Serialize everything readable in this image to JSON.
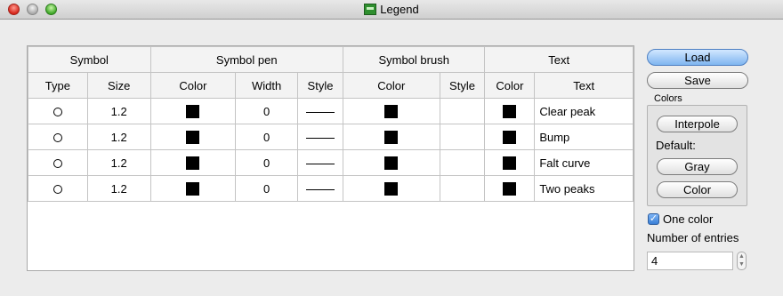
{
  "window": {
    "title": "Legend",
    "icon": "legend-app-icon"
  },
  "table": {
    "group_headers": [
      "Symbol",
      "Symbol pen",
      "Symbol brush",
      "Text"
    ],
    "columns": [
      "Type",
      "Size",
      "Color",
      "Width",
      "Style",
      "Color",
      "Style",
      "Color",
      "Text"
    ],
    "rows": [
      {
        "type": "circle",
        "size": "1.2",
        "pen_color": "#000000",
        "width": "0",
        "pen_style": "solid-line",
        "brush_color": "#000000",
        "brush_style": "",
        "text_color": "#000000",
        "text": "Clear peak"
      },
      {
        "type": "circle",
        "size": "1.2",
        "pen_color": "#000000",
        "width": "0",
        "pen_style": "solid-line",
        "brush_color": "#000000",
        "brush_style": "",
        "text_color": "#000000",
        "text": "Bump"
      },
      {
        "type": "circle",
        "size": "1.2",
        "pen_color": "#000000",
        "width": "0",
        "pen_style": "solid-line",
        "brush_color": "#000000",
        "brush_style": "",
        "text_color": "#000000",
        "text": "Falt curve"
      },
      {
        "type": "circle",
        "size": "1.2",
        "pen_color": "#000000",
        "width": "0",
        "pen_style": "solid-line",
        "brush_color": "#000000",
        "brush_style": "",
        "text_color": "#000000",
        "text": "Two peaks"
      }
    ]
  },
  "buttons": {
    "load": "Load",
    "save": "Save"
  },
  "colors_group": {
    "label": "Colors",
    "interpole": "Interpole",
    "default_label": "Default:",
    "gray": "Gray",
    "color": "Color"
  },
  "one_color": {
    "label": "One color",
    "checked": true
  },
  "entries": {
    "label": "Number of entries",
    "value": "4"
  }
}
